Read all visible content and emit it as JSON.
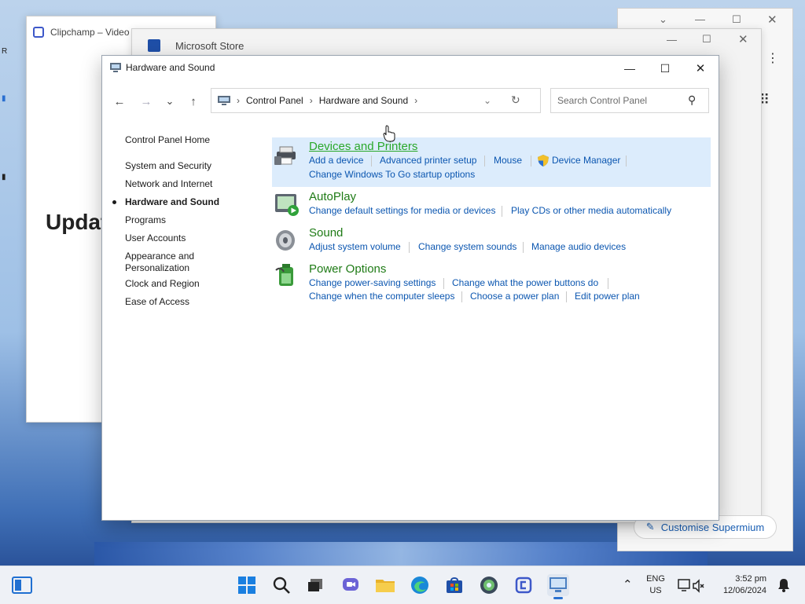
{
  "background_windows": {
    "clipchamp_title": "Clipchamp – Video",
    "clipchamp_heading": "Updat",
    "store_title": "Microsoft Store",
    "supermium_button": "Customise Supermium"
  },
  "window": {
    "title": "Hardware and Sound",
    "minimize": "—",
    "maximize": "☐",
    "close": "✕"
  },
  "nav": {
    "back": "←",
    "forward": "→",
    "recent": "⌄",
    "up": "↑",
    "breadcrumb": [
      "Control Panel",
      "Hardware and Sound"
    ],
    "search_placeholder": "Search Control Panel"
  },
  "sidebar": {
    "home": "Control Panel Home",
    "items": [
      {
        "label": "System and Security"
      },
      {
        "label": "Network and Internet"
      },
      {
        "label": "Hardware and Sound",
        "current": true
      },
      {
        "label": "Programs"
      },
      {
        "label": "User Accounts"
      },
      {
        "label": "Appearance and Personalization"
      },
      {
        "label": "Clock and Region"
      },
      {
        "label": "Ease of Access"
      }
    ]
  },
  "categories": [
    {
      "title": "Devices and Printers",
      "icon": "printer-icon",
      "tasks": [
        "Add a device",
        "Advanced printer setup",
        "Mouse",
        "Device Manager",
        "Change Windows To Go startup options"
      ]
    },
    {
      "title": "AutoPlay",
      "icon": "autoplay-icon",
      "tasks": [
        "Change default settings for media or devices",
        "Play CDs or other media automatically"
      ]
    },
    {
      "title": "Sound",
      "icon": "speaker-icon",
      "tasks": [
        "Adjust system volume",
        "Change system sounds",
        "Manage audio devices"
      ]
    },
    {
      "title": "Power Options",
      "icon": "power-options-icon",
      "tasks": [
        "Change power-saving settings",
        "Change what the power buttons do",
        "Change when the computer sleeps",
        "Choose a power plan",
        "Edit power plan"
      ]
    }
  ],
  "taskbar": {
    "lang_line1": "ENG",
    "lang_line2": "US",
    "time": "3:52 pm",
    "date": "12/06/2024"
  }
}
